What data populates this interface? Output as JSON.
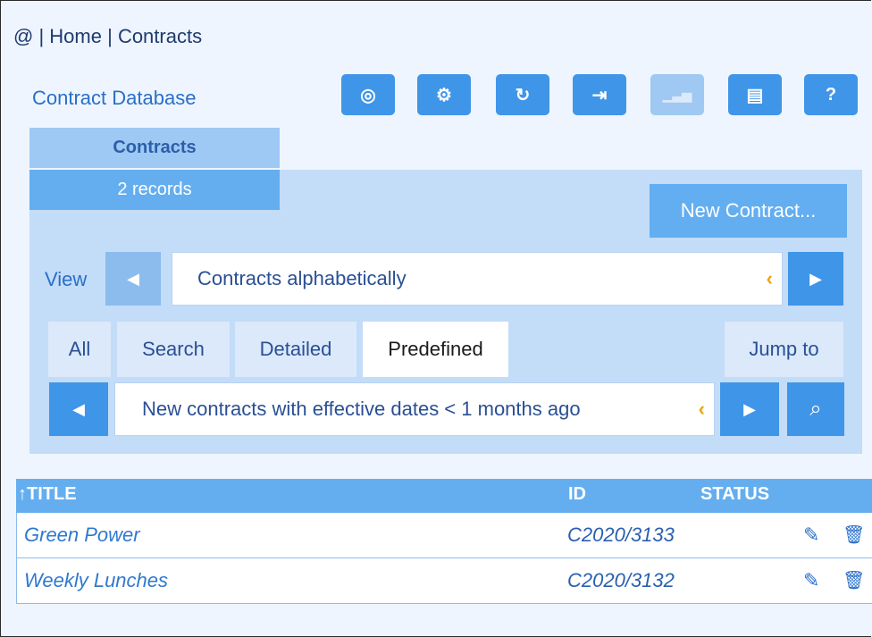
{
  "breadcrumb": {
    "root": "@",
    "sep": " | ",
    "home": "Home",
    "current": "Contracts"
  },
  "db_title": "Contract Database",
  "toolbar": [
    {
      "icon": "fingerprint-icon",
      "glyph": "◎",
      "disabled": false
    },
    {
      "icon": "settings-icon",
      "glyph": "⚙",
      "disabled": false
    },
    {
      "icon": "refresh-icon",
      "glyph": "↻",
      "disabled": false
    },
    {
      "icon": "export-icon",
      "glyph": "⇥",
      "disabled": false
    },
    {
      "icon": "chart-icon",
      "glyph": "▁▃▅",
      "disabled": true
    },
    {
      "icon": "print-icon",
      "glyph": "▤",
      "disabled": false
    },
    {
      "icon": "help-icon",
      "glyph": "?",
      "disabled": false
    }
  ],
  "contracts_tab": {
    "label": "Contracts",
    "records": "2 records"
  },
  "new_contract_label": "New Contract...",
  "view": {
    "label": "View",
    "selected": "Contracts alphabetically",
    "prev": "◀",
    "next": "▶",
    "chevron": "‹"
  },
  "filter_tabs": {
    "all": "All",
    "search": "Search",
    "detailed": "Detailed",
    "predefined": "Predefined",
    "jump": "Jump to"
  },
  "filter": {
    "selected": "New contracts with effective dates < 1 months ago",
    "prev": "◀",
    "next": "▶",
    "search_glyph": "⌕",
    "chevron": "‹"
  },
  "grid": {
    "headers": {
      "title": "↑TITLE",
      "id": "ID",
      "status": "STATUS"
    },
    "rows": [
      {
        "title": "Green Power",
        "id": "C2020/3133",
        "status": ""
      },
      {
        "title": "Weekly Lunches",
        "id": "C2020/3132",
        "status": ""
      }
    ],
    "edit_glyph": "✎",
    "delete_glyph": "🗑"
  },
  "colors": {
    "accent": "#3f95e8",
    "panel": "#c3dcf8",
    "chevron": "#f0a500"
  }
}
